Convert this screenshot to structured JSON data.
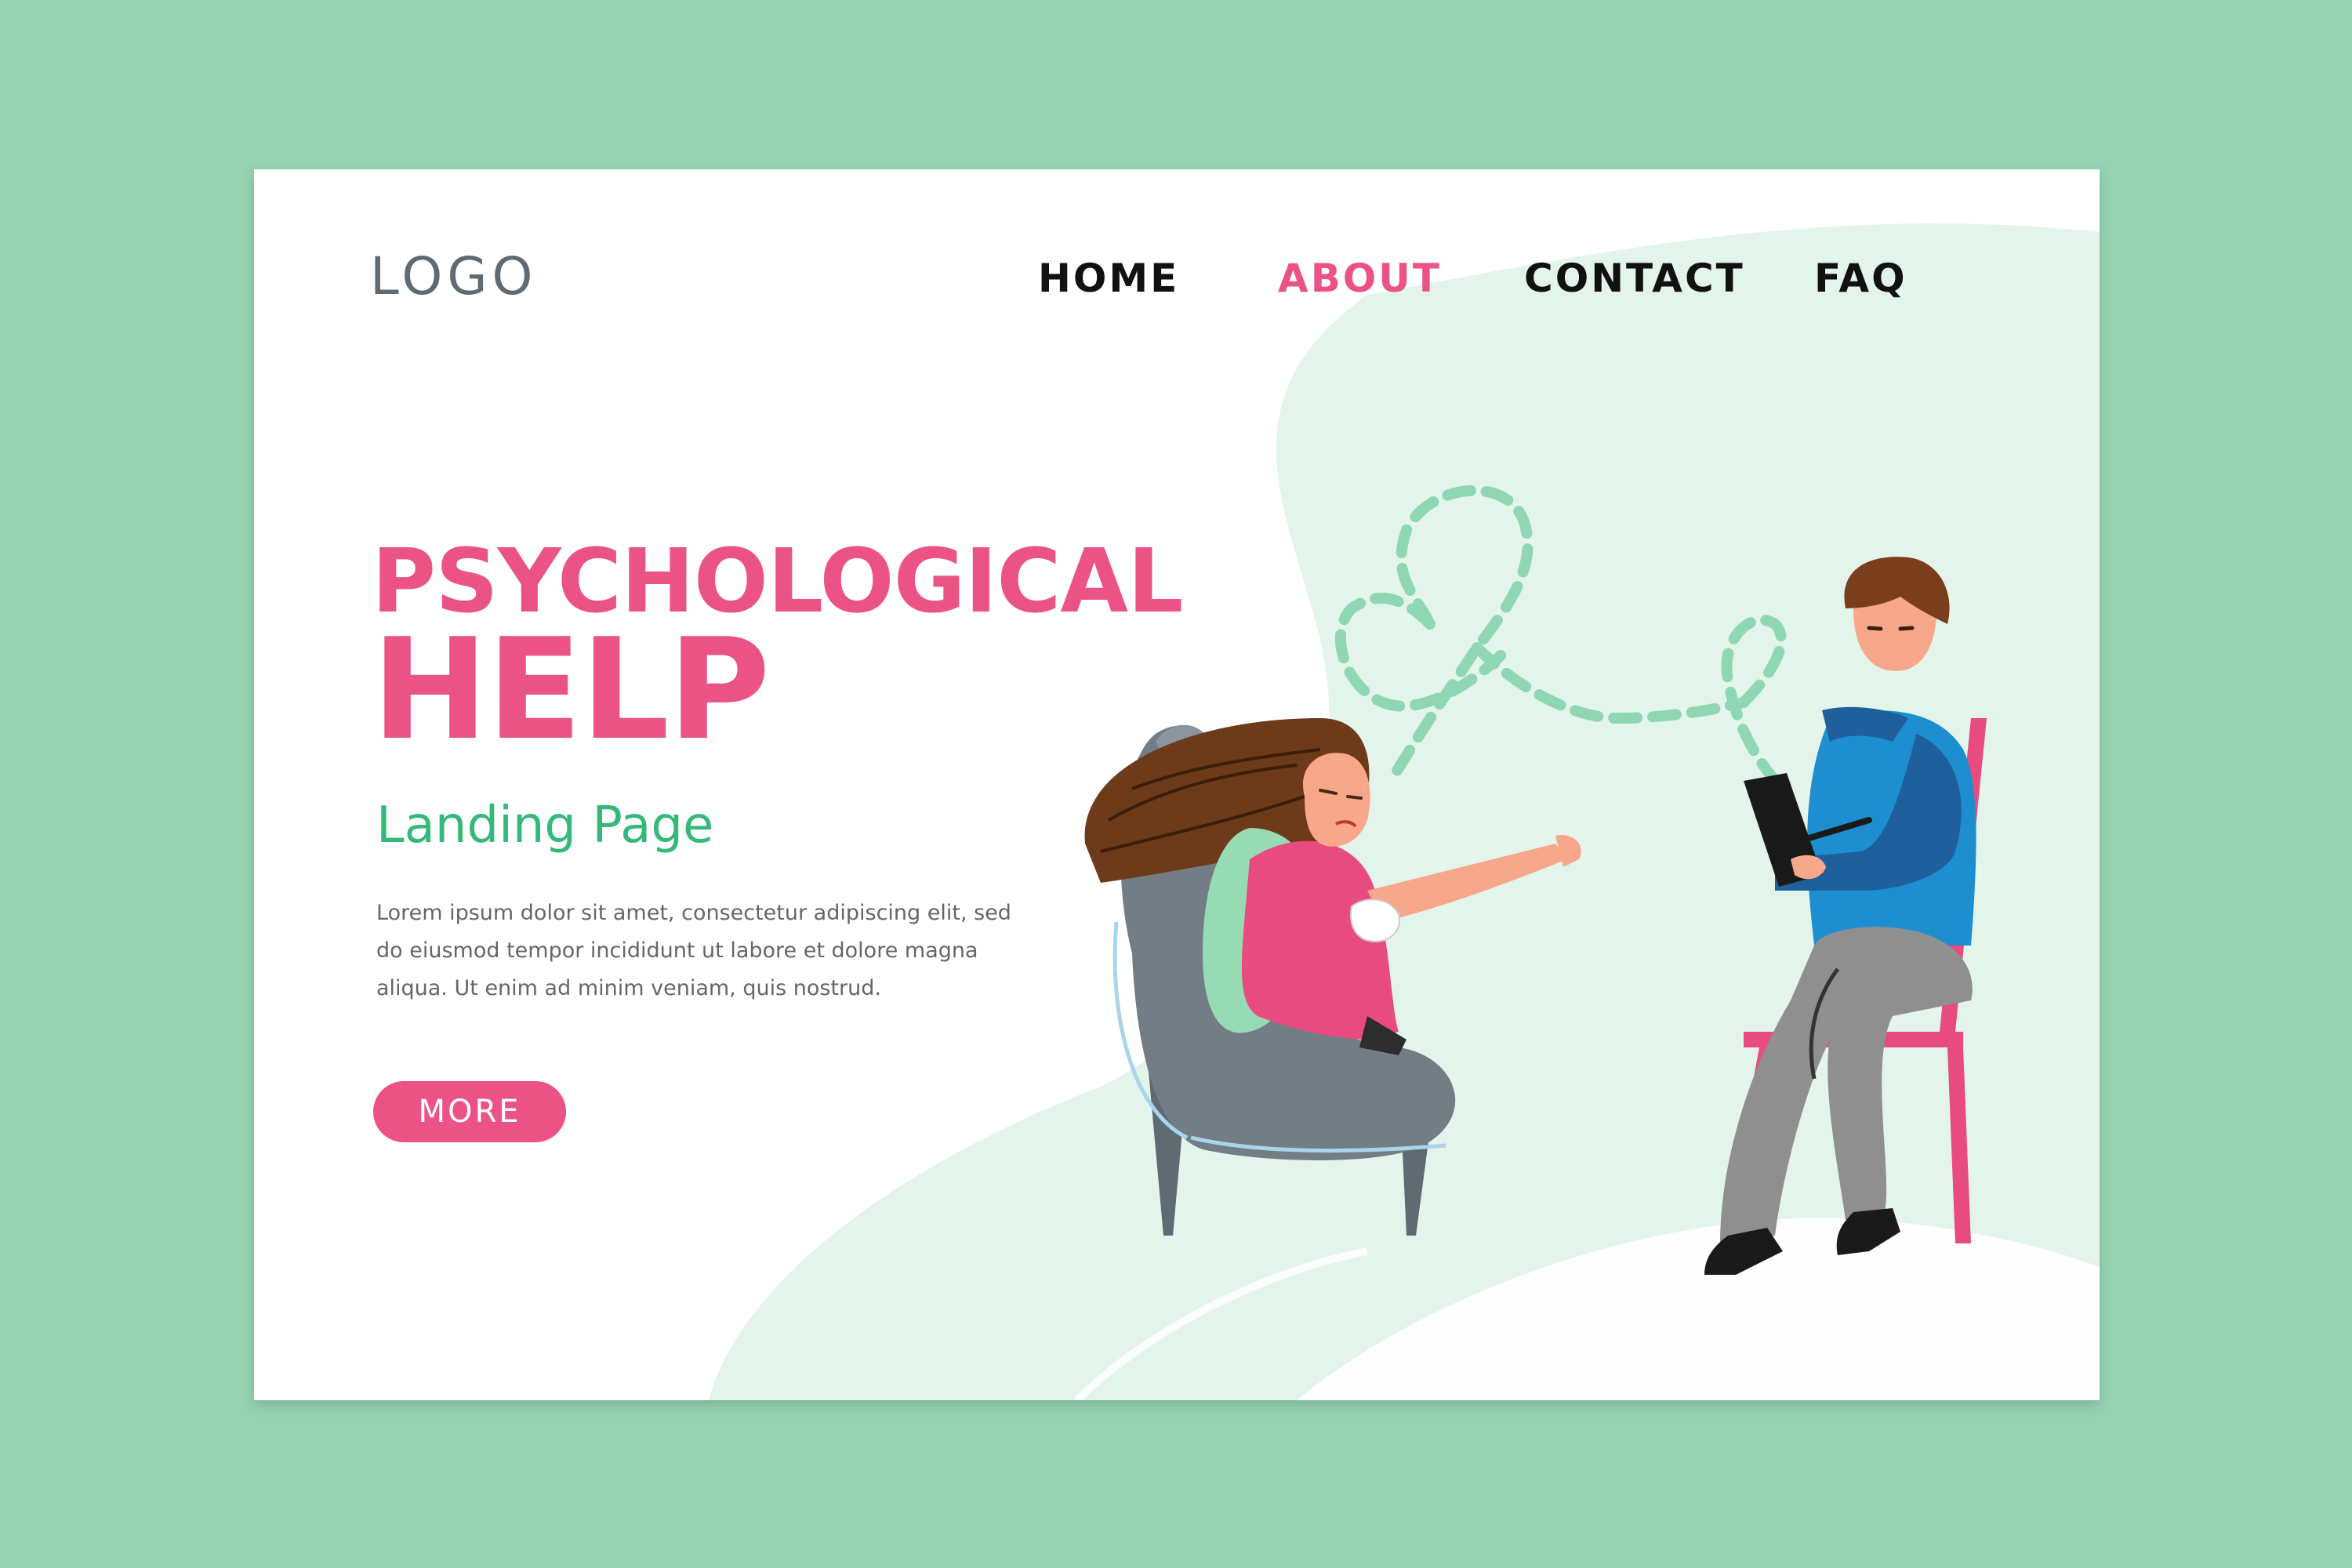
{
  "header": {
    "logo": "LOGO",
    "nav": [
      {
        "label": "HOME",
        "active": false
      },
      {
        "label": "ABOUT",
        "active": true
      },
      {
        "label": "CONTACT",
        "active": false
      },
      {
        "label": "FAQ",
        "active": false
      }
    ]
  },
  "hero": {
    "title_line1": "PSYCHOLOGICAL",
    "title_line2": "HELP",
    "subtitle": "Landing Page",
    "body": "Lorem ipsum dolor sit amet, consectetur adipiscing elit, sed do eiusmod tempor incididunt ut labore et dolore magna aliqua.  Ut enim ad minim veniam, quis nostrud.",
    "more_label": "MORE"
  },
  "colors": {
    "page_background": "#97d3b2",
    "accent_pink": "#ea5384",
    "accent_green": "#35b979",
    "blob_green": "#e3f4ea"
  },
  "illustration": {
    "icons": [
      "ribbon-doodle",
      "armchair",
      "therapy-patient",
      "therapist",
      "tablet",
      "chair"
    ]
  }
}
